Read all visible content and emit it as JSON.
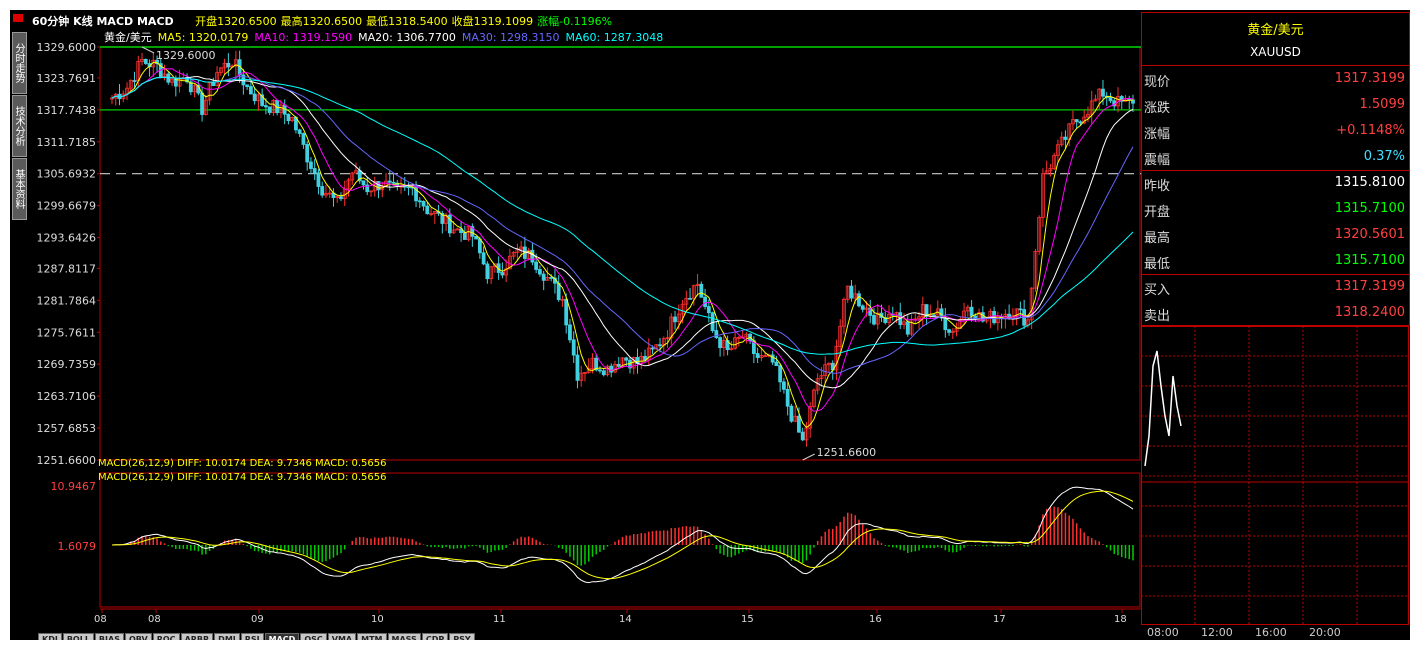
{
  "header": {
    "period": "60分钟 K线 MACD MACD",
    "ohlc": [
      {
        "label": "开盘",
        "value": "1320.6500",
        "color": "#ffff00"
      },
      {
        "label": "最高",
        "value": "1320.6500",
        "color": "#ffff00"
      },
      {
        "label": "最低",
        "value": "1318.5400",
        "color": "#ffff00"
      },
      {
        "label": "收盘",
        "value": "1319.1099",
        "color": "#ffff00"
      },
      {
        "label": "涨幅",
        "value": "-0.1196%",
        "color": "#00ff00"
      }
    ],
    "ma_line": [
      {
        "text": "黄金/美元",
        "color": "#ffffff"
      },
      {
        "text": "MA5: 1320.0179",
        "color": "#ffff00"
      },
      {
        "text": "MA10: 1319.1590",
        "color": "#ff00ff"
      },
      {
        "text": "MA20: 1306.7700",
        "color": "#ffffff"
      },
      {
        "text": "MA30: 1298.3150",
        "color": "#6666ff"
      },
      {
        "text": "MA60: 1287.3048",
        "color": "#00ffff"
      }
    ],
    "macd_line": "MACD(26,12,9) DIFF: 10.0174 DEA: 9.7346 MACD: 0.5656"
  },
  "left_tabs": [
    "分时走势",
    "技术分析",
    "基本资料"
  ],
  "chart_data": [
    {
      "type": "candlestick",
      "title": "60分钟 K线",
      "y_ticks": [
        "1329.6000",
        "1323.7691",
        "1317.7438",
        "1311.7185",
        "1305.6932",
        "1299.6679",
        "1293.6426",
        "1287.8117",
        "1281.7864",
        "1275.7611",
        "1269.7359",
        "1263.7106",
        "1257.6853",
        "1251.6600"
      ],
      "ylim": [
        1251.66,
        1329.6
      ],
      "x_labels": [
        "08",
        "09",
        "10",
        "11",
        "14",
        "15",
        "16",
        "17",
        "18"
      ],
      "annotations": [
        {
          "text": "1329.6000",
          "value": 1329.6
        },
        {
          "text": "1251.6600",
          "value": 1251.66
        }
      ],
      "reference_lines": [
        {
          "value": 1329.6,
          "color": "#00ff00"
        },
        {
          "value": 1317.74,
          "color": "#00cc00"
        },
        {
          "value": 1305.69,
          "color": "#cccccc"
        }
      ],
      "close_path": [
        1320,
        1322,
        1327,
        1326,
        1323,
        1324,
        1318,
        1325,
        1327,
        1322,
        1319,
        1318,
        1316,
        1309,
        1303,
        1300,
        1306,
        1303,
        1304,
        1302,
        1303,
        1299,
        1297,
        1295,
        1294,
        1287,
        1288,
        1291,
        1290,
        1286,
        1282,
        1268,
        1270,
        1269,
        1271,
        1270,
        1272,
        1276,
        1282,
        1285,
        1276,
        1272,
        1275,
        1271,
        1270,
        1262,
        1255,
        1267,
        1270,
        1284,
        1281,
        1278,
        1280,
        1276,
        1280,
        1279,
        1276,
        1281,
        1278,
        1279,
        1280,
        1278,
        1305,
        1310,
        1315,
        1318,
        1321,
        1319,
        1319
      ]
    },
    {
      "type": "macd",
      "title": "MACD(26,12,9)",
      "y_ticks": [
        "10.9467",
        "1.6079"
      ],
      "series": [
        {
          "name": "DIFF",
          "color": "#ffffff"
        },
        {
          "name": "DEA",
          "color": "#ffff00"
        },
        {
          "name": "MACD",
          "color": "#ff3333"
        }
      ]
    }
  ],
  "quote": {
    "title": "黄金/美元",
    "symbol": "XAUUSD",
    "rows": [
      {
        "label": "现价",
        "value": "1317.3199",
        "color": "#ff4040"
      },
      {
        "label": "涨跌",
        "value": "1.5099",
        "color": "#ff4040"
      },
      {
        "label": "涨幅",
        "value": "+0.1148%",
        "color": "#ff4040"
      },
      {
        "label": "震幅",
        "value": "0.37%",
        "color": "#40e0ff"
      },
      {
        "label": "昨收",
        "value": "1315.8100",
        "color": "#ffffff"
      },
      {
        "label": "开盘",
        "value": "1315.7100",
        "color": "#00ff00"
      },
      {
        "label": "最高",
        "value": "1320.5601",
        "color": "#ff4040"
      },
      {
        "label": "最低",
        "value": "1315.7100",
        "color": "#00ff00"
      },
      {
        "label": "买入",
        "value": "1317.3199",
        "color": "#ff4040"
      },
      {
        "label": "卖出",
        "value": "1318.2400",
        "color": "#ff4040"
      }
    ]
  },
  "mini_times": [
    "08:00",
    "12:00",
    "16:00",
    "20:00"
  ],
  "bottom_tabs": [
    "KDJ",
    "BOLL",
    "BIAS",
    "OBV",
    "ROC",
    "ARBR",
    "DMI",
    "RSI",
    "MACD",
    "OSC",
    "VMA",
    "MTM",
    "MASS",
    "CDP",
    "PSY"
  ],
  "active_tab": "MACD"
}
